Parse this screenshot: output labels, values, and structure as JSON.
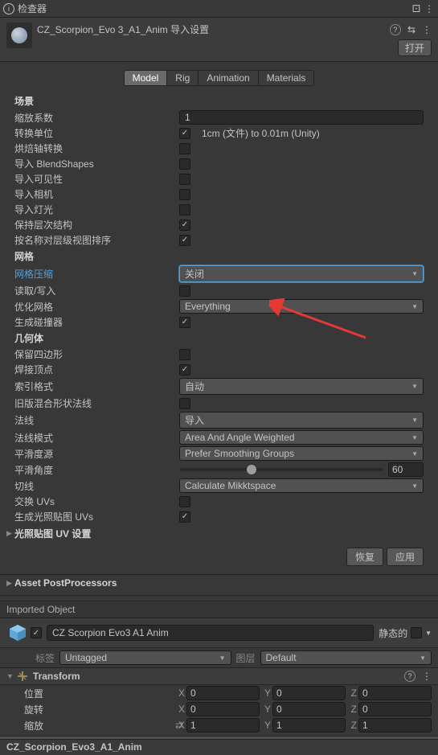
{
  "panel": {
    "title": "检查器"
  },
  "asset": {
    "name": "CZ_Scorpion_Evo 3_A1_Anim 导入设置",
    "open_btn": "打开"
  },
  "tabs": [
    "Model",
    "Rig",
    "Animation",
    "Materials"
  ],
  "active_tab": 0,
  "sections": {
    "scene": "场景",
    "mesh": "网格",
    "geometry": "几何体"
  },
  "fields": {
    "scale_factor": {
      "label": "缩放系数",
      "value": "1"
    },
    "convert_units": {
      "label": "转换单位",
      "checked": true,
      "text": "1cm (文件) to 0.01m (Unity)"
    },
    "bake_axis": {
      "label": "烘焙轴转换",
      "checked": false
    },
    "import_blendshapes": {
      "label": "导入 BlendShapes",
      "checked": false
    },
    "import_visibility": {
      "label": "导入可见性",
      "checked": false
    },
    "import_cameras": {
      "label": "导入相机",
      "checked": false
    },
    "import_lights": {
      "label": "导入灯光",
      "checked": false
    },
    "preserve_hierarchy": {
      "label": "保持层次结构",
      "checked": true
    },
    "sort_hierarchy": {
      "label": "按名称对层级视图排序",
      "checked": true
    },
    "mesh_compression": {
      "label": "网格压缩",
      "value": "关闭"
    },
    "read_write": {
      "label": "读取/写入",
      "checked": false
    },
    "optimize_mesh": {
      "label": "优化网格",
      "value": "Everything"
    },
    "generate_colliders": {
      "label": "生成碰撞器",
      "checked": true
    },
    "keep_quads": {
      "label": "保留四边形",
      "checked": false
    },
    "weld_vertices": {
      "label": "焊接顶点",
      "checked": true
    },
    "index_format": {
      "label": "索引格式",
      "value": "自动"
    },
    "legacy_blend": {
      "label": "旧版混合形状法线",
      "checked": false
    },
    "normals": {
      "label": "法线",
      "value": "导入"
    },
    "normals_mode": {
      "label": "法线模式",
      "value": "Area And Angle Weighted"
    },
    "smoothness_source": {
      "label": "平滑度源",
      "value": "Prefer Smoothing Groups"
    },
    "smoothing_angle": {
      "label": "平滑角度",
      "value": "60"
    },
    "tangents": {
      "label": "切线",
      "value": "Calculate Mikktspace"
    },
    "swap_uvs": {
      "label": "交换 UVs",
      "checked": false
    },
    "generate_lightmap_uvs": {
      "label": "生成光照贴图 UVs",
      "checked": true
    }
  },
  "foldouts": {
    "lightmap_uv": "光照贴图 UV 设置",
    "asset_postprocessors": "Asset PostProcessors"
  },
  "buttons": {
    "revert": "恢复",
    "apply": "应用"
  },
  "imported_object": {
    "header": "Imported Object",
    "name": "CZ Scorpion Evo3 A1 Anim",
    "static_label": "静态的",
    "tag_label": "标签",
    "tag_value": "Untagged",
    "layer_label": "图层",
    "layer_value": "Default"
  },
  "transform": {
    "title": "Transform",
    "position": {
      "label": "位置",
      "x": "0",
      "y": "0",
      "z": "0"
    },
    "rotation": {
      "label": "旋转",
      "x": "0",
      "y": "0",
      "z": "0"
    },
    "scale": {
      "label": "缩放",
      "x": "1",
      "y": "1",
      "z": "1"
    }
  },
  "footer": "CZ_Scorpion_Evo3_A1_Anim"
}
